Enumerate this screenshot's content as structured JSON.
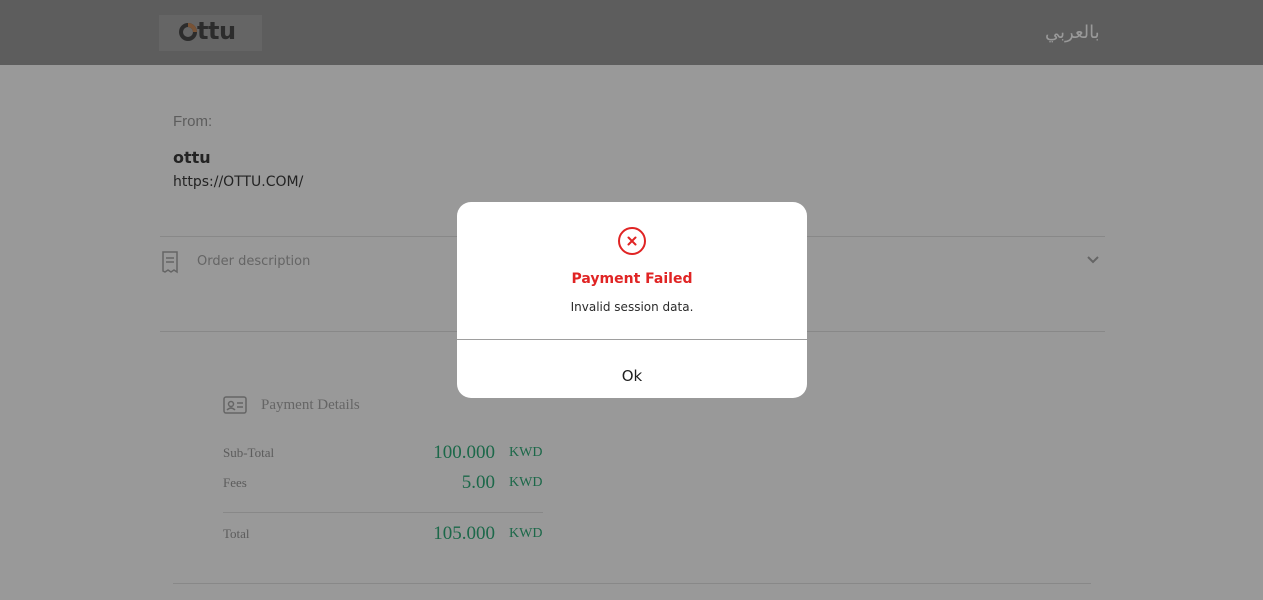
{
  "header": {
    "logo_text": "ttu",
    "language_link": "بالعربي"
  },
  "merchant": {
    "from_label": "From:",
    "name": "ottu",
    "url": "https://OTTU.COM/"
  },
  "order": {
    "label": "Order description"
  },
  "payment_details": {
    "title": "Payment Details",
    "rows": [
      {
        "label": "Sub-Total",
        "amount": "100.000",
        "currency": "KWD"
      },
      {
        "label": "Fees",
        "amount": "5.00",
        "currency": "KWD"
      },
      {
        "label": "Total",
        "amount": "105.000",
        "currency": "KWD"
      }
    ]
  },
  "modal": {
    "title": "Payment Failed",
    "message": "Invalid session data.",
    "ok_label": "Ok"
  },
  "colors": {
    "error": "#e02424",
    "amount": "#2fae7b",
    "overlay": "rgba(0,0,0,0.4)"
  },
  "icons": {
    "logo": "ottu-logo",
    "order": "receipt-icon",
    "chevron": "chevron-down-icon",
    "payment": "id-card-icon",
    "error": "error-circle-x-icon"
  }
}
